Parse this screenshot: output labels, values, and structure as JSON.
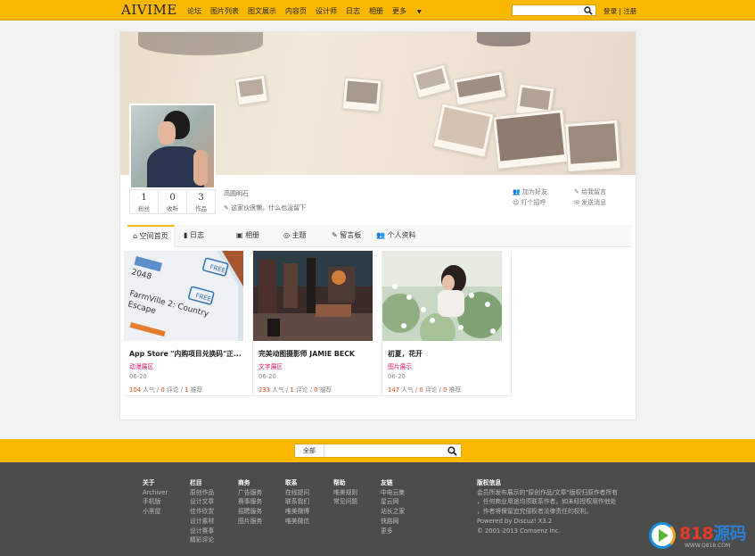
{
  "header": {
    "logo": "AIVIME",
    "nav": [
      "论坛",
      "图片列表",
      "图文展示",
      "内容页",
      "设计师",
      "日志",
      "相册"
    ],
    "more": "更多",
    "search_placeholder": "",
    "login": "登录",
    "register": "注册",
    "login_sep": "|"
  },
  "profile": {
    "stats": [
      {
        "value": "1",
        "label": "粉丝"
      },
      {
        "value": "0",
        "label": "收听"
      },
      {
        "value": "3",
        "label": "作品"
      }
    ],
    "username": "高圆明石",
    "signature": "这家伙很懒，什么也没留下",
    "actions_left": [
      "加为好友",
      "打个招呼"
    ],
    "actions_right": [
      "给我留言",
      "发送消息"
    ]
  },
  "tabs": [
    {
      "icon": "home-icon",
      "label": "空间首页",
      "active": true
    },
    {
      "icon": "book-icon",
      "label": "日志"
    },
    {
      "icon": "album-icon",
      "label": "相册"
    },
    {
      "icon": "chat-icon",
      "label": "主题"
    },
    {
      "icon": "pencil-icon",
      "label": "留言板"
    },
    {
      "icon": "users-icon",
      "label": "个人资料"
    }
  ],
  "items": [
    {
      "title": "App Store \"内购项目兑换码\"正...",
      "category": "动漫展区",
      "date": "06-20",
      "views": "104",
      "views_label": "人气",
      "comments": "0",
      "comments_label": "评论",
      "likes": "1",
      "likes_label": "推荐"
    },
    {
      "title": "完美动图摄影师 JAMIE BECK",
      "category": "文字展区",
      "date": "06-20",
      "views": "233",
      "views_label": "人气",
      "comments": "1",
      "comments_label": "评论",
      "likes": "0",
      "likes_label": "推荐"
    },
    {
      "title": "初夏，花开",
      "category": "图片展示",
      "date": "06-20",
      "views": "147",
      "views_label": "人气",
      "comments": "0",
      "comments_label": "评论",
      "likes": "0",
      "likes_label": "推荐"
    }
  ],
  "footer_search": {
    "category": "全部",
    "placeholder": ""
  },
  "footer": {
    "cols": [
      {
        "title": "关于",
        "links": [
          "Archiver",
          "手机版",
          "小黑屋"
        ]
      },
      {
        "title": "栏目",
        "links": [
          "原创作品",
          "设计文章",
          "佳作欣赏",
          "设计素材",
          "设计赛事",
          "精彩评论"
        ]
      },
      {
        "title": "商务",
        "links": [
          "广告服务",
          "赛事服务",
          "招聘服务",
          "图片服务"
        ]
      },
      {
        "title": "联系",
        "links": [
          "在线提问",
          "联系我们",
          "唯美微博",
          "唯美微信"
        ]
      },
      {
        "title": "帮助",
        "links": [
          "唯美规则",
          "常见问题"
        ]
      },
      {
        "title": "友链",
        "links": [
          "中电云集",
          "星云网",
          "站长之家",
          "快路网",
          "更多"
        ]
      }
    ],
    "copyright": {
      "title": "版权信息",
      "lines": [
        "会员所发布展示的\"原创作品/文章\"版权归原作者所有",
        "，任何商业用途均须联系作者。如未经授权用作他处",
        "，作者将保留追究侵权者法律责任的权利。",
        "Powered by Discuz! X3.2",
        "© 2001-2013 Comsenz Inc."
      ]
    }
  },
  "watermark": {
    "brand_num": "818",
    "brand_txt": "源码",
    "url": "WWW.Q818.COM"
  }
}
